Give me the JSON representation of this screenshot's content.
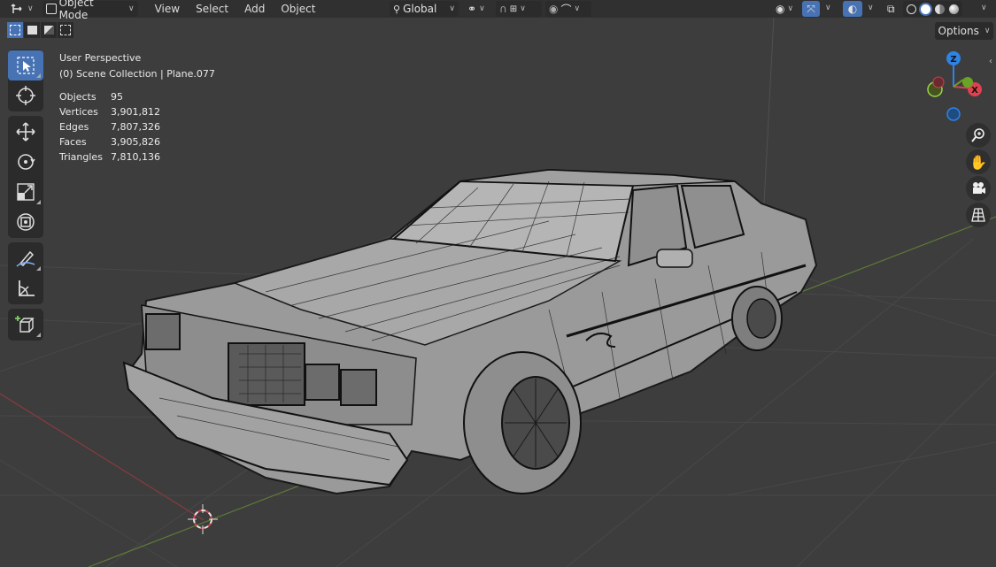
{
  "header": {
    "editor_type_icon": "3d-viewport-icon",
    "mode": {
      "icon": "object-mode-icon",
      "label": "Object Mode"
    },
    "menus": [
      "View",
      "Select",
      "Add",
      "Object"
    ],
    "transform_orientation": {
      "icon": "global-orientation-icon",
      "label": "Global"
    },
    "pivot_icon": "pivot-point-icon",
    "snap_icons": [
      "snap-magnet-icon",
      "snap-increment-icon"
    ],
    "proportional_icons": [
      "proportional-edit-icon",
      "falloff-curve-icon"
    ],
    "right_icons": [
      "visibility-icon",
      "gizmo-icon",
      "overlay-icon",
      "xray-icon"
    ],
    "shading": [
      "wireframe",
      "solid",
      "material",
      "rendered"
    ],
    "active_shading": "solid"
  },
  "select_modes": [
    "select-new-icon",
    "select-extend-icon",
    "select-subtract-icon",
    "select-intersect-icon"
  ],
  "options_label": "Options",
  "toolbar": {
    "groups": [
      [
        "select-box-icon",
        "cursor-icon"
      ],
      [
        "move-icon",
        "rotate-icon",
        "scale-icon",
        "transform-icon"
      ],
      [
        "annotate-icon",
        "measure-icon"
      ],
      [
        "add-cube-icon"
      ]
    ],
    "active": "select-box-icon"
  },
  "viewport": {
    "perspective": "User Perspective",
    "collection": "(0) Scene Collection | Plane.077",
    "stats": [
      {
        "label": "Objects",
        "value": "95"
      },
      {
        "label": "Vertices",
        "value": "3,901,812"
      },
      {
        "label": "Edges",
        "value": "7,807,326"
      },
      {
        "label": "Faces",
        "value": "3,905,826"
      },
      {
        "label": "Triangles",
        "value": "7,810,136"
      }
    ]
  },
  "gizmo": {
    "z_label": "Z",
    "x_label": "X",
    "y_label": ""
  },
  "nav_buttons": [
    "zoom-icon",
    "pan-hand-icon",
    "camera-icon",
    "grid-ortho-icon"
  ],
  "colors": {
    "active_blue": "#4772b3",
    "axis_x": "#e0414f",
    "axis_y": "#6aa325",
    "axis_z": "#2f83e4",
    "background": "#3d3d3d",
    "header": "#303030"
  }
}
